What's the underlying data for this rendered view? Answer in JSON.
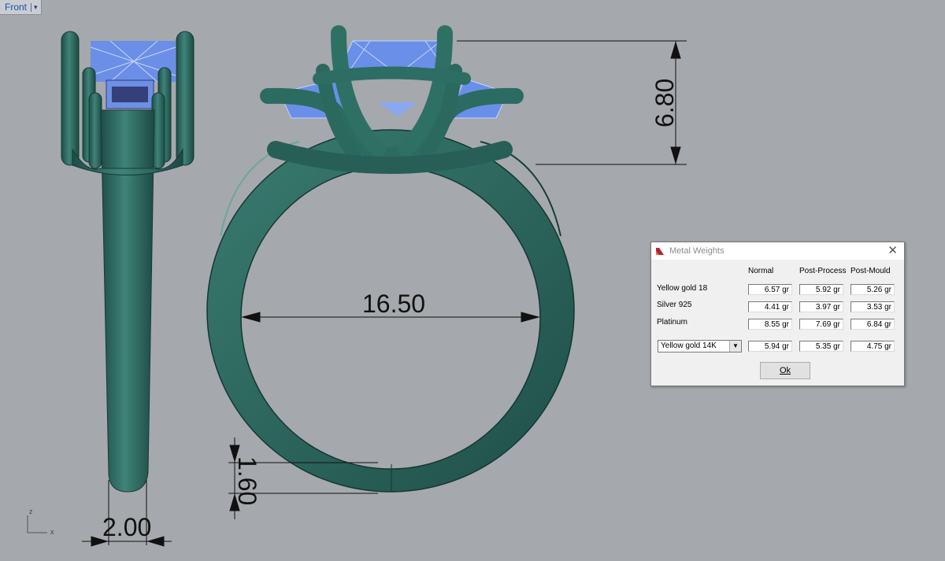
{
  "viewport": {
    "name": "Front",
    "menu_arrow": "▾",
    "axis_z": "z",
    "axis_x": "x"
  },
  "dimensions": {
    "stone_height": "6.80",
    "inner_diameter": "16.50",
    "band_thickness": "1.60",
    "band_width": "2.00"
  },
  "colors": {
    "metal": "#2d6d63",
    "gem_wire": "#5d86e6",
    "background": "#a5a8ac"
  },
  "dialog": {
    "title": "Metal Weights",
    "icon": "metal-weights-app-icon",
    "close_label": "✕",
    "columns": [
      "Normal",
      "Post-Process",
      "Post-Mould"
    ],
    "rows": [
      {
        "label": "Yellow gold 18",
        "values": [
          "6.57 gr",
          "5.92 gr",
          "5.26 gr"
        ]
      },
      {
        "label": "Silver 925",
        "values": [
          "4.41 gr",
          "3.97 gr",
          "3.53 gr"
        ]
      },
      {
        "label": "Platinum",
        "values": [
          "8.55 gr",
          "7.69 gr",
          "6.84 gr"
        ]
      }
    ],
    "custom_metal": {
      "selected": "Yellow gold 14K",
      "values": [
        "5.94 gr",
        "5.35 gr",
        "4.75 gr"
      ]
    },
    "ok_label": "Ok"
  }
}
